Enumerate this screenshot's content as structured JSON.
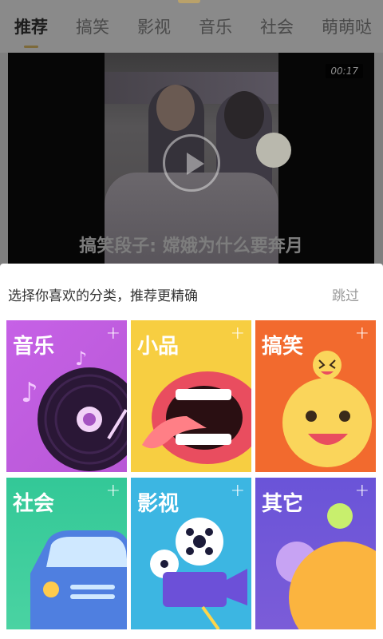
{
  "tabs": [
    {
      "label": "推荐",
      "active": true
    },
    {
      "label": "搞笑",
      "active": false
    },
    {
      "label": "影视",
      "active": false
    },
    {
      "label": "音乐",
      "active": false
    },
    {
      "label": "社会",
      "active": false
    },
    {
      "label": "萌萌哒",
      "active": false
    }
  ],
  "video": {
    "duration": "00:17",
    "title": "搞笑段子: 嫦娥为什么要奔月"
  },
  "sheet": {
    "title": "选择你喜欢的分类，推荐更精确",
    "skip_label": "跳过",
    "plus_symbol": "+",
    "categories": [
      {
        "label": "音乐",
        "color": "#c661e6",
        "icon": "vinyl-record-icon"
      },
      {
        "label": "小品",
        "color": "#f7ce41",
        "icon": "mouth-icon"
      },
      {
        "label": "搞笑",
        "color": "#f26a2e",
        "icon": "laughing-emoji-icon"
      },
      {
        "label": "社会",
        "color": "#33c897",
        "icon": "car-icon"
      },
      {
        "label": "影视",
        "color": "#3cb6e2",
        "icon": "film-camera-icon"
      },
      {
        "label": "其它",
        "color": "#6a54d8",
        "icon": "planets-icon"
      }
    ]
  }
}
